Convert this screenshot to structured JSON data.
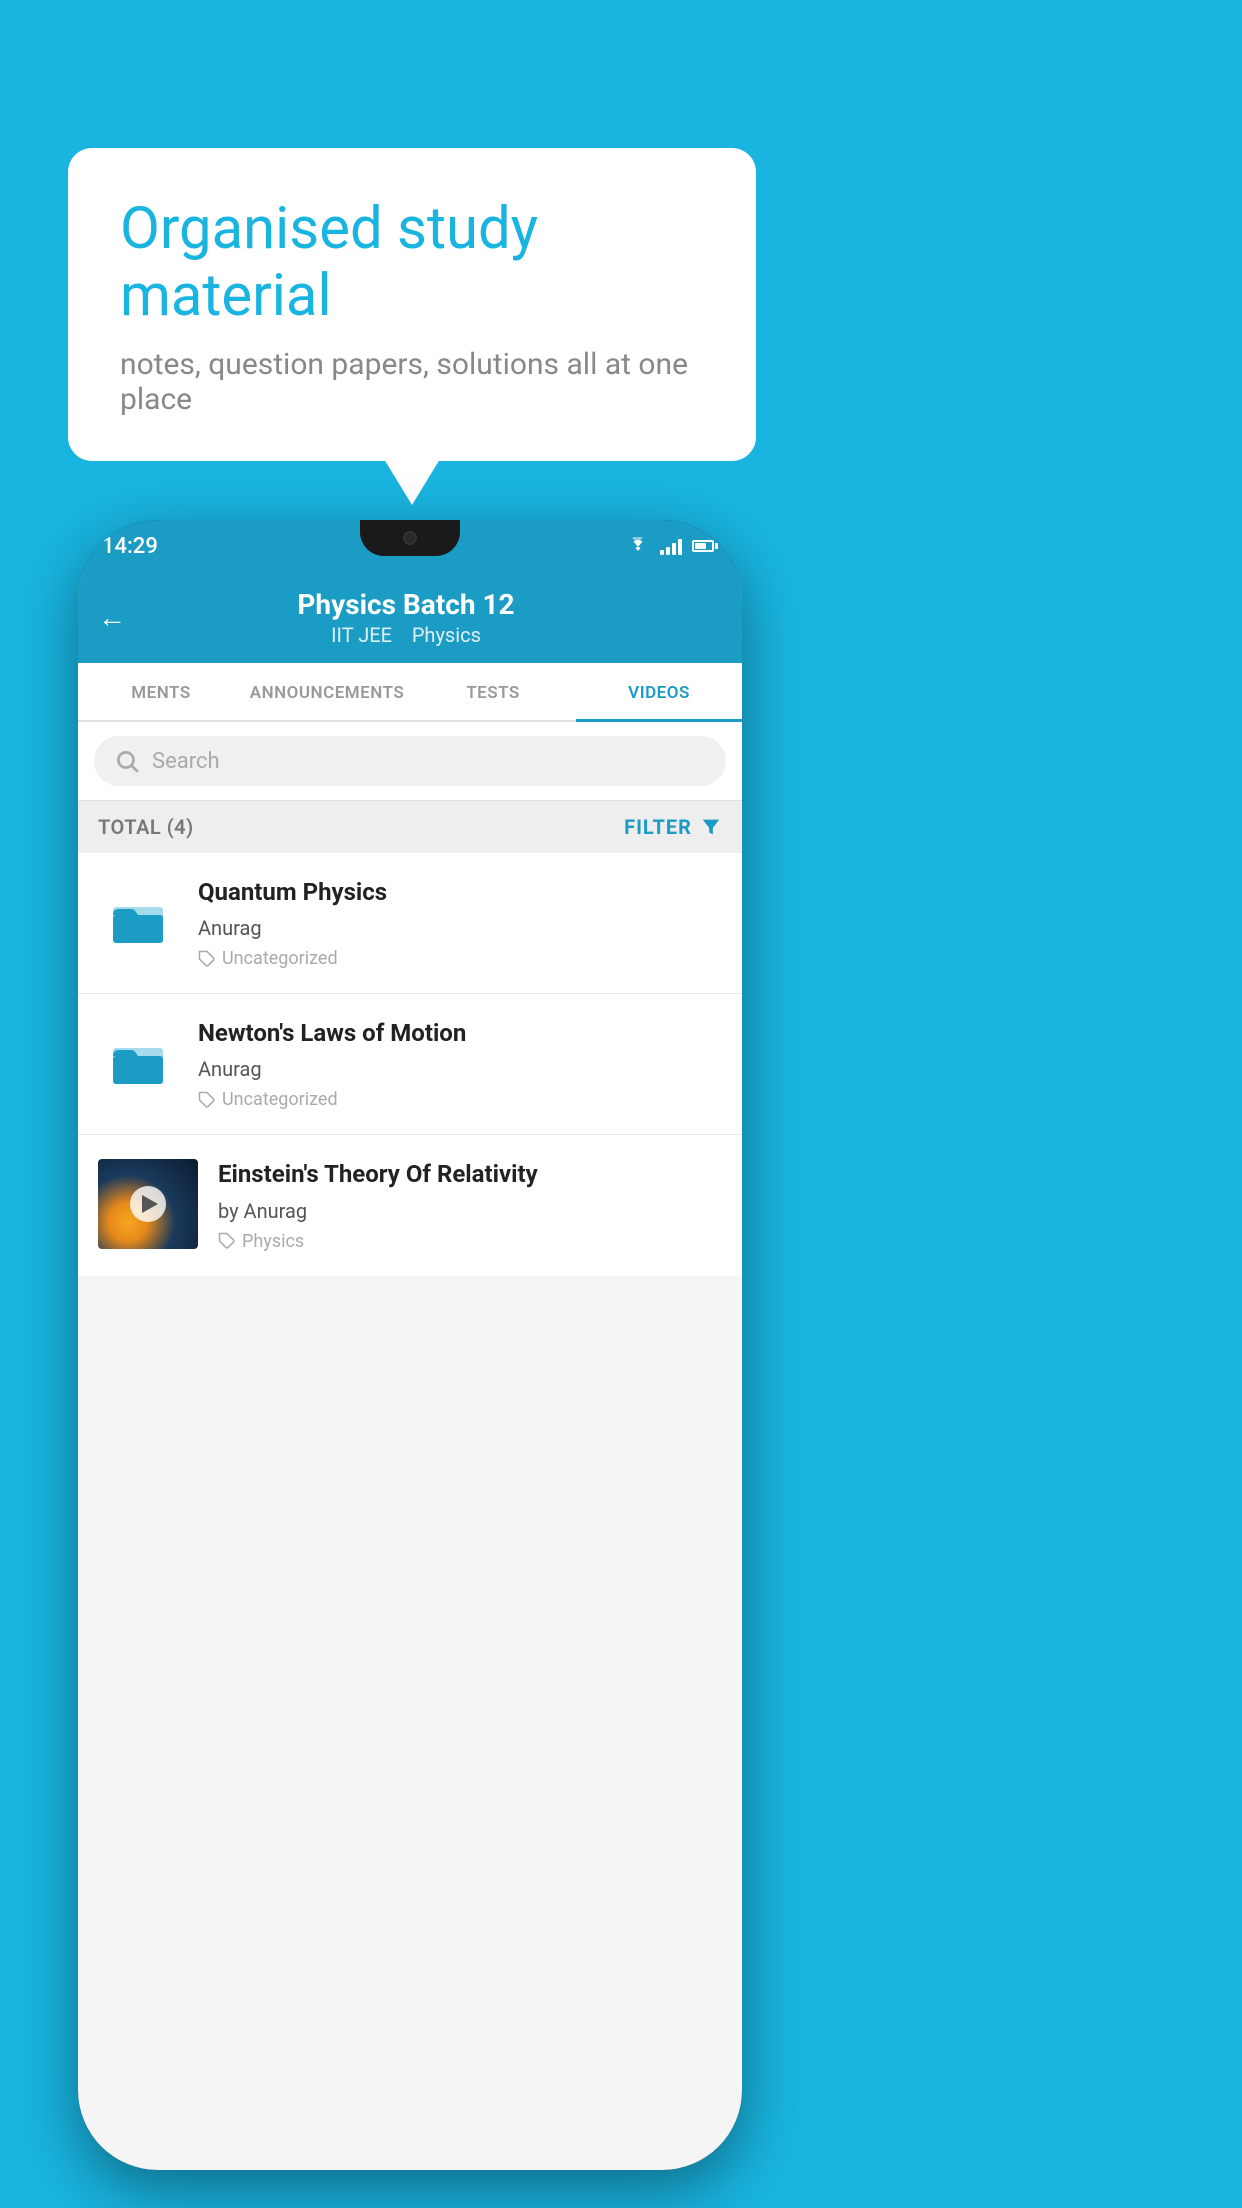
{
  "background_color": "#19b4e0",
  "bubble": {
    "title": "Organised study material",
    "subtitle": "notes, question papers, solutions all at one place"
  },
  "phone": {
    "status_bar": {
      "time": "14:29"
    },
    "header": {
      "title": "Physics Batch 12",
      "subtitle_parts": [
        "IIT JEE",
        "Physics"
      ],
      "back_label": "←"
    },
    "tabs": [
      {
        "label": "MENTS",
        "active": false
      },
      {
        "label": "ANNOUNCEMENTS",
        "active": false
      },
      {
        "label": "TESTS",
        "active": false
      },
      {
        "label": "VIDEOS",
        "active": true
      }
    ],
    "search": {
      "placeholder": "Search"
    },
    "filter_bar": {
      "total_label": "TOTAL (4)",
      "filter_label": "FILTER"
    },
    "videos": [
      {
        "id": 1,
        "title": "Quantum Physics",
        "author": "Anurag",
        "tag": "Uncategorized",
        "type": "folder",
        "has_thumbnail": false
      },
      {
        "id": 2,
        "title": "Newton's Laws of Motion",
        "author": "Anurag",
        "tag": "Uncategorized",
        "type": "folder",
        "has_thumbnail": false
      },
      {
        "id": 3,
        "title": "Einstein's Theory Of Relativity",
        "author": "by Anurag",
        "tag": "Physics",
        "type": "video",
        "has_thumbnail": true
      }
    ]
  }
}
